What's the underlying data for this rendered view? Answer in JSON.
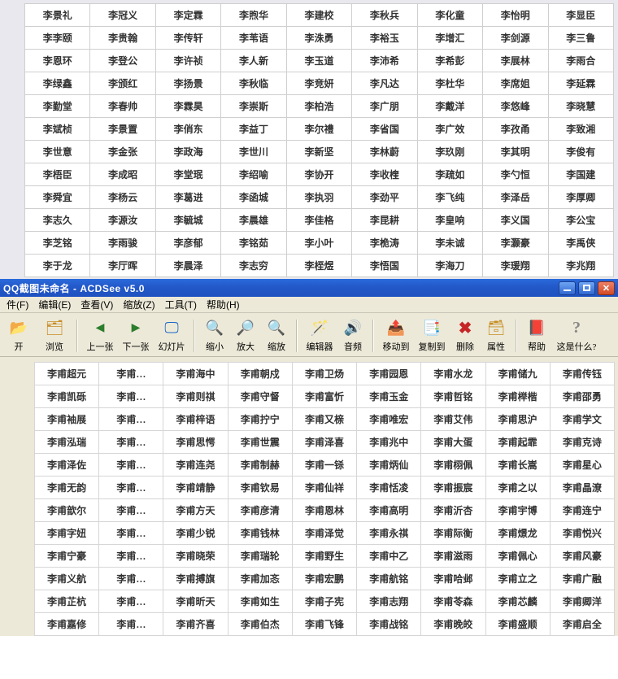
{
  "topGrid": [
    [
      "李景礼",
      "李冠义",
      "李定霖",
      "李煦华",
      "李建校",
      "李秋兵",
      "李化童",
      "李怡明",
      "李显臣"
    ],
    [
      "李李颐",
      "李贵翰",
      "李传轩",
      "李苇语",
      "李洙勇",
      "李裕玉",
      "李增汇",
      "李剑源",
      "李三鲁"
    ],
    [
      "李恩环",
      "李登公",
      "李许祯",
      "李人新",
      "李玉道",
      "李沛希",
      "李希彭",
      "李展林",
      "李雨合"
    ],
    [
      "李绿鑫",
      "李颁红",
      "李扬景",
      "李秋临",
      "李竞妍",
      "李凡达",
      "李杜华",
      "李席姐",
      "李延霖"
    ],
    [
      "李勤堂",
      "李春帅",
      "李霖昊",
      "李崇斯",
      "李柏浩",
      "李广朋",
      "李戴洋",
      "李悠峰",
      "李晓慧"
    ],
    [
      "李斌桢",
      "李景置",
      "李俏东",
      "李益丁",
      "李尔禮",
      "李省国",
      "李广效",
      "李孜甬",
      "李致湘"
    ],
    [
      "李世意",
      "李金张",
      "李政海",
      "李世川",
      "李新坚",
      "李林蔚",
      "李玖刚",
      "李其明",
      "李俊有"
    ],
    [
      "李梧臣",
      "李成昭",
      "李堂珉",
      "李绍喻",
      "李协开",
      "李收楏",
      "李疏如",
      "李勺恒",
      "李国建"
    ],
    [
      "李舜宜",
      "李杨云",
      "李葛进",
      "李函城",
      "李执羽",
      "李劲平",
      "李飞纯",
      "李泽岳",
      "李厚卿"
    ],
    [
      "李志久",
      "李源汝",
      "李毓城",
      "李晨雄",
      "李佳格",
      "李昆耕",
      "李皇响",
      "李义国",
      "李公宝"
    ],
    [
      "李芝铭",
      "李雨骏",
      "李彦郁",
      "李铭茹",
      "李小叶",
      "李桅涛",
      "李未诚",
      "李灏豪",
      "李禹侠"
    ],
    [
      "李于龙",
      "李厅晖",
      "李晨泽",
      "李志穷",
      "李桎煜",
      "李悟国",
      "李海刀",
      "李瑗翔",
      "李兆翔"
    ]
  ],
  "window": {
    "title": "QQ截图未命名 - ACDSee v5.0"
  },
  "menu": [
    {
      "label": "件(F)"
    },
    {
      "label": "编辑(E)"
    },
    {
      "label": "查看(V)"
    },
    {
      "label": "缩放(Z)"
    },
    {
      "label": "工具(T)"
    },
    {
      "label": "帮助(H)"
    }
  ],
  "toolbar": [
    {
      "icon": "ico-open",
      "label": "开",
      "name": "open-button"
    },
    {
      "icon": "ico-browse",
      "label": "浏览",
      "name": "browse-button"
    },
    {
      "sep": true
    },
    {
      "icon": "ico-prev",
      "label": "上一张",
      "name": "prev-button"
    },
    {
      "icon": "ico-next",
      "label": "下一张",
      "name": "next-button"
    },
    {
      "icon": "ico-slide",
      "label": "幻灯片",
      "name": "slideshow-button"
    },
    {
      "sep": true
    },
    {
      "icon": "ico-zoomout",
      "label": "缩小",
      "name": "zoom-out-button",
      "narrow": true
    },
    {
      "icon": "ico-zoomin",
      "label": "放大",
      "name": "zoom-in-button",
      "narrow": true
    },
    {
      "icon": "ico-zoom",
      "label": "缩放",
      "name": "zoom-button",
      "narrow": true
    },
    {
      "sep": true
    },
    {
      "icon": "ico-editor",
      "label": "编辑器",
      "name": "editor-button"
    },
    {
      "icon": "ico-audio",
      "label": "音频",
      "name": "audio-button",
      "narrow": true
    },
    {
      "sep": true
    },
    {
      "icon": "ico-move",
      "label": "移动到",
      "name": "move-to-button"
    },
    {
      "icon": "ico-copy",
      "label": "复制到",
      "name": "copy-to-button"
    },
    {
      "icon": "ico-del",
      "label": "删除",
      "name": "delete-button",
      "narrow": true
    },
    {
      "icon": "ico-prop",
      "label": "属性",
      "name": "properties-button",
      "narrow": true
    },
    {
      "sep": true
    },
    {
      "icon": "ico-help",
      "label": "帮助",
      "name": "help-button",
      "narrow": true
    },
    {
      "icon": "ico-what",
      "label": "这是什么?",
      "name": "whats-this-button",
      "wide": true
    }
  ],
  "bottomGrid": [
    [
      "李甫超元",
      "李甫…",
      "李甫海中",
      "李甫朝戍",
      "李甫卫炀",
      "李甫园恩",
      "李甫水龙",
      "李甫储九",
      "李甫传钰"
    ],
    [
      "李甫凯砾",
      "李甫…",
      "李甫则祺",
      "李甫守督",
      "李甫富忻",
      "李甫玉金",
      "李甫哲铭",
      "李甫榉楷",
      "李甫邵勇"
    ],
    [
      "李甫袖展",
      "李甫…",
      "李甫梓语",
      "李甫拧宁",
      "李甫又榇",
      "李甫唯宏",
      "李甫艾伟",
      "李甫思沪",
      "李甫学文"
    ],
    [
      "李甫泓瑞",
      "李甫…",
      "李甫思愕",
      "李甫世震",
      "李甫泽喜",
      "李甫兆中",
      "李甫大蛋",
      "李甫起霏",
      "李甫克诗"
    ],
    [
      "李甫泽佐",
      "李甫…",
      "李甫连尧",
      "李甫制赫",
      "李甫一铩",
      "李甫炳仙",
      "李甫栩佩",
      "李甫长嵩",
      "李甫星心"
    ],
    [
      "李甫无韵",
      "李甫…",
      "李甫靖静",
      "李甫钦易",
      "李甫仙祥",
      "李甫恬凌",
      "李甫振宸",
      "李甫之以",
      "李甫晶潦"
    ],
    [
      "李甫歆尔",
      "李甫…",
      "李甫方天",
      "李甫彦清",
      "李甫恩林",
      "李甫高明",
      "李甫沂杏",
      "李甫宇博",
      "李甫连宁"
    ],
    [
      "李甫字妞",
      "李甫…",
      "李甫少锐",
      "李甫钱林",
      "李甫泽觉",
      "李甫永祺",
      "李甫际衡",
      "李甫燝龙",
      "李甫悦兴"
    ],
    [
      "李甫宁豪",
      "李甫…",
      "李甫晓荣",
      "李甫瑞轮",
      "李甫野生",
      "李甫中乙",
      "李甫滋雨",
      "李甫佩心",
      "李甫风豪"
    ],
    [
      "李甫义航",
      "李甫…",
      "李甫搏旗",
      "李甫加忞",
      "李甫宏鹏",
      "李甫航铭",
      "李甫哈邺",
      "李甫立之",
      "李甫广融"
    ],
    [
      "李甫芷杭",
      "李甫…",
      "李甫昕天",
      "李甫如生",
      "李甫子宪",
      "李甫志翔",
      "李甫苓森",
      "李甫芯麟",
      "李甫卿洋"
    ],
    [
      "李甫嘉修",
      "李甫…",
      "李甫齐喜",
      "李甫伯杰",
      "李甫飞锋",
      "李甫战铭",
      "李甫晚皎",
      "李甫盛顺",
      "李甫启全"
    ]
  ]
}
